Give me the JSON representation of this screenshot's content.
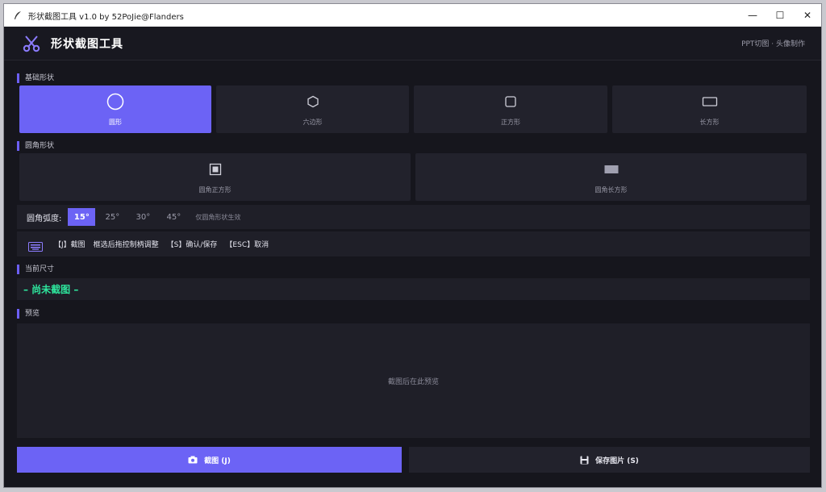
{
  "window": {
    "title": "形状截图工具 v1.0 by 52PoJie@Flanders",
    "minimize": "—",
    "maximize": "☐",
    "close": "✕"
  },
  "header": {
    "title": "形状截图工具",
    "subtitle": "PPT切图 · 头像制作",
    "logo_icon": "scissors-icon"
  },
  "basic_shapes": {
    "label": "基础形状",
    "items": [
      {
        "label": "圆形",
        "icon": "circle-icon",
        "active": true
      },
      {
        "label": "六边形",
        "icon": "hexagon-icon",
        "active": false
      },
      {
        "label": "正方形",
        "icon": "square-icon",
        "active": false
      },
      {
        "label": "长方形",
        "icon": "rectangle-icon",
        "active": false
      }
    ]
  },
  "rounded_shapes": {
    "label": "圆角形状",
    "items": [
      {
        "label": "圆角正方形",
        "icon": "rounded-square-icon",
        "active": false
      },
      {
        "label": "圆角长方形",
        "icon": "rounded-rectangle-icon",
        "active": false
      }
    ]
  },
  "radius": {
    "label": "圆角弧度:",
    "options": [
      "15°",
      "25°",
      "30°",
      "45°"
    ],
    "selected": "15°",
    "note": "仅圆角形状生效"
  },
  "hints": {
    "icon": "keyboard-icon",
    "items": [
      "【J】截图",
      "框选后拖控制柄调整",
      "【S】确认/保存",
      "【ESC】取消"
    ]
  },
  "current_size": {
    "label": "当前尺寸",
    "value": "– 尚未截图 –"
  },
  "preview": {
    "label": "预览",
    "placeholder": "截图后在此预览"
  },
  "actions": {
    "capture": "截图 (J)",
    "save": "保存图片 (S)"
  },
  "colors": {
    "accent": "#6c63f5",
    "success": "#2ee59d",
    "background": "#16161d",
    "card": "#22222c"
  }
}
